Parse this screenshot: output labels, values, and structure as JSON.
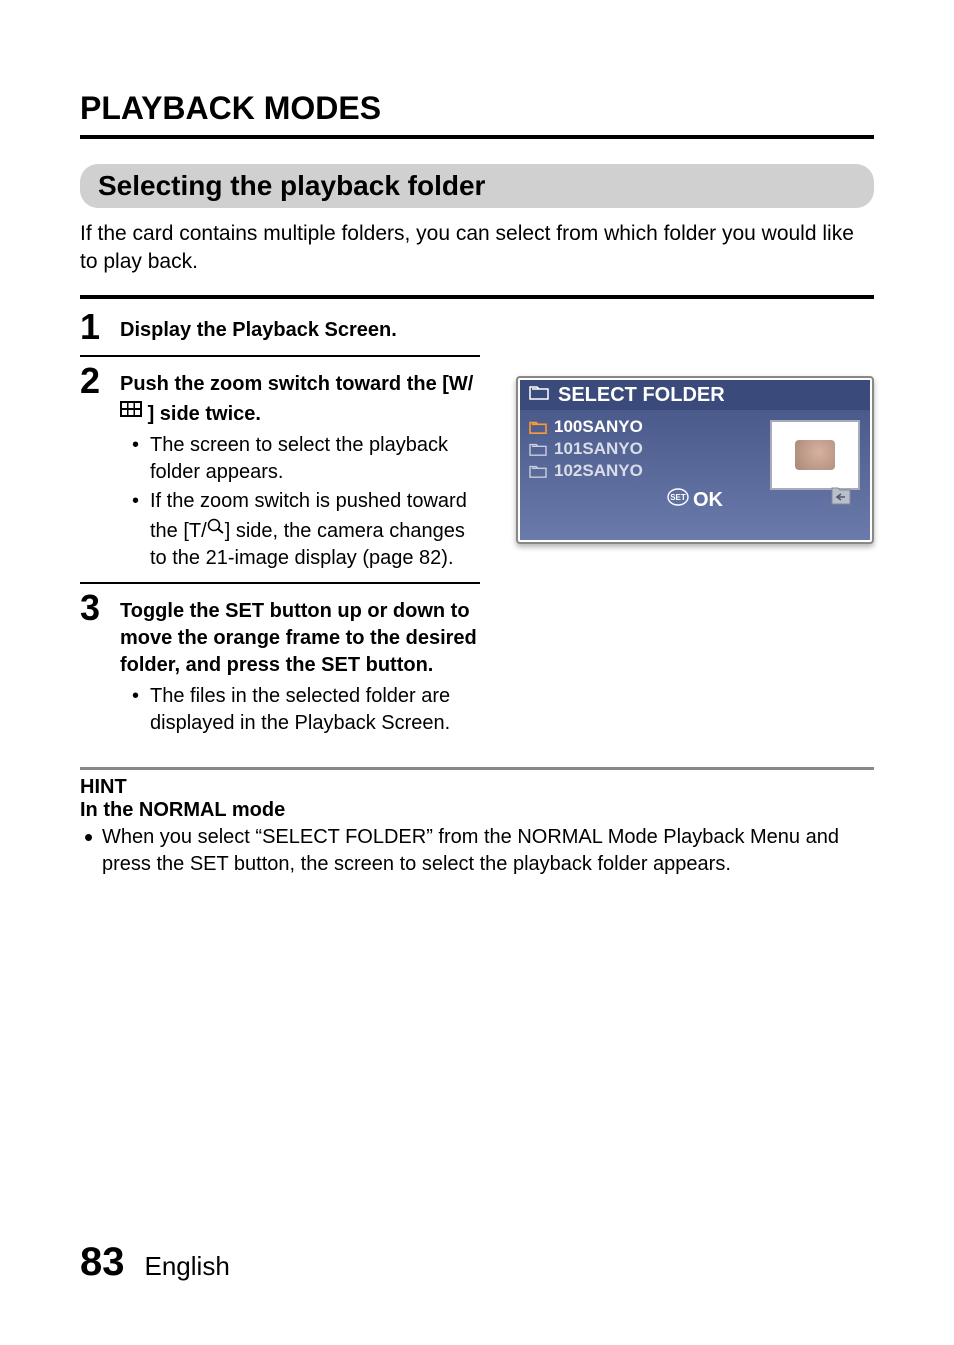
{
  "title": "PLAYBACK MODES",
  "section_header": "Selecting the playback folder",
  "intro": "If the card contains multiple folders, you can select from which folder you would like to play back.",
  "steps": [
    {
      "num": "1",
      "bold": "Display the Playback Screen.",
      "bullets": []
    },
    {
      "num": "2",
      "bold_pre": "Push the zoom switch toward the [W/",
      "bold_post": "] side twice.",
      "bullets": [
        "The screen to select the playback folder appears.",
        "If the zoom switch is pushed toward the [T/  ] side, the camera changes to the 21-image display  (page 82)."
      ]
    },
    {
      "num": "3",
      "bold": "Toggle the SET button up or down to move the orange frame to the desired folder, and press the SET button.",
      "bullets": [
        "The files in the selected folder are displayed in the Playback Screen."
      ]
    }
  ],
  "screen": {
    "title": "SELECT FOLDER",
    "folders": [
      "100SANYO",
      "101SANYO",
      "102SANYO"
    ],
    "ok": "OK"
  },
  "hint": {
    "label": "HINT",
    "subtitle": "In the NORMAL mode",
    "body": "When you select “SELECT FOLDER” from the NORMAL Mode Playback Menu and press the SET button, the screen to select the playback folder appears."
  },
  "footer": {
    "page": "83",
    "lang": "English"
  }
}
